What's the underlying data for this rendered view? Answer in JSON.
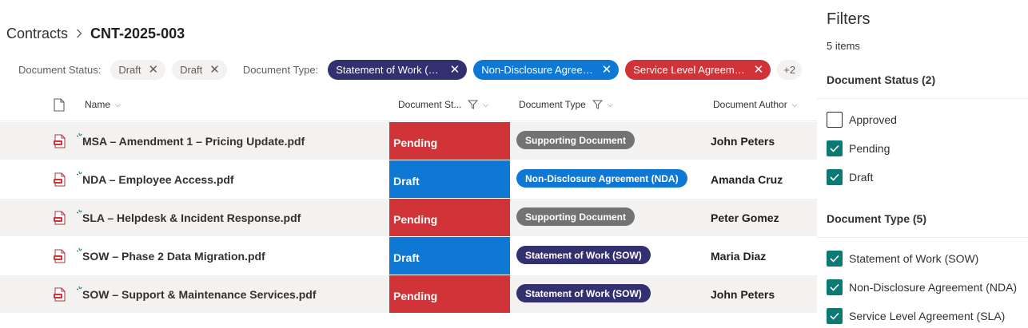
{
  "breadcrumb": {
    "root": "Contracts",
    "current": "CNT-2025-003"
  },
  "filter_bar": {
    "status_label": "Document Status:",
    "status_pills": [
      "Draft",
      "Draft"
    ],
    "type_label": "Document Type:",
    "type_pills": [
      "Statement of Work (SOW)",
      "Non-Disclosure Agreeme...",
      "Service Level Agreement ..."
    ],
    "more": "+2"
  },
  "columns": {
    "name": "Name",
    "status": "Document St...",
    "type": "Document Type",
    "author": "Document Author"
  },
  "rows": [
    {
      "name": "MSA – Amendment 1 – Pricing Update.pdf",
      "status": "Pending",
      "type": "Supporting Document",
      "author": "John Peters"
    },
    {
      "name": "NDA – Employee Access.pdf",
      "status": "Draft",
      "type": "Non-Disclosure Agreement (NDA)",
      "author": "Amanda Cruz"
    },
    {
      "name": "SLA – Helpdesk & Incident Response.pdf",
      "status": "Pending",
      "type": "Supporting Document",
      "author": "Peter Gomez"
    },
    {
      "name": "SOW – Phase 2 Data Migration.pdf",
      "status": "Draft",
      "type": "Statement of Work (SOW)",
      "author": "Maria Diaz"
    },
    {
      "name": "SOW – Support & Maintenance Services.pdf",
      "status": "Pending",
      "type": "Statement of Work (SOW)",
      "author": "John Peters"
    }
  ],
  "filters": {
    "title": "Filters",
    "count": "5 items",
    "status_section": "Document Status (2)",
    "status_options": [
      {
        "label": "Approved",
        "checked": false
      },
      {
        "label": "Pending",
        "checked": true
      },
      {
        "label": "Draft",
        "checked": true
      }
    ],
    "type_section": "Document Type (5)",
    "type_options": [
      {
        "label": "Statement of Work (SOW)",
        "checked": true
      },
      {
        "label": "Non-Disclosure Agreement (NDA)",
        "checked": true
      },
      {
        "label": "Service Level Agreement (SLA)",
        "checked": true
      }
    ]
  },
  "colors": {
    "pending": "#d13438",
    "draft": "#0e78d4",
    "sow": "#32306e",
    "nda": "#0e78d4",
    "sla": "#d13438",
    "supporting": "#737373",
    "checkbox": "#0b7a75"
  },
  "icons": {
    "file": "pdf-file-icon",
    "new": "new-item-sparkle-icon",
    "header_doc": "document-icon",
    "filter": "funnel-icon",
    "sort": "chevron-down-icon",
    "remove": "close-icon",
    "breadcrumb_sep": "chevron-right-icon",
    "check": "checkmark-icon"
  }
}
